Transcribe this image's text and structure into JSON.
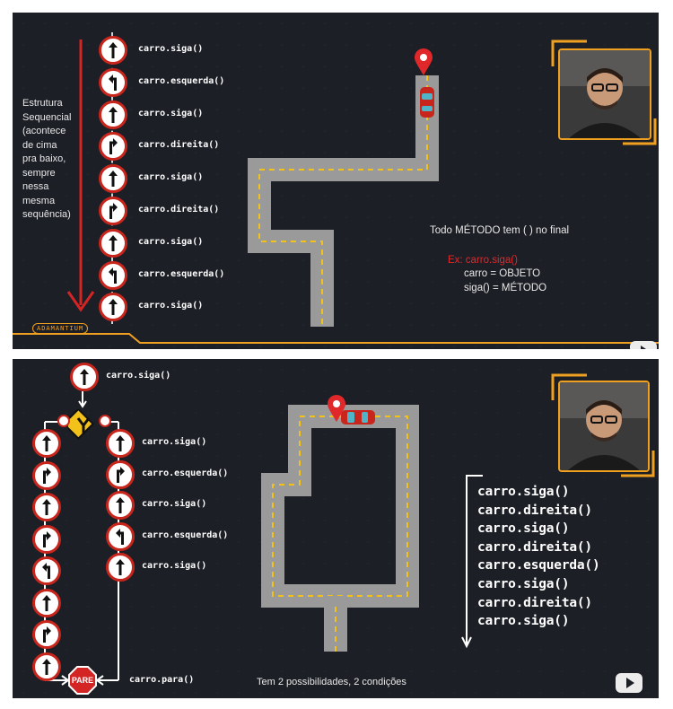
{
  "panel1": {
    "sidebar_text": [
      "Estrutura",
      "Sequencial",
      "(acontece",
      "de cima",
      "pra baixo,",
      "sempre",
      "nessa",
      "mesma",
      "sequência)"
    ],
    "commands": [
      {
        "icon": "arrow-up-icon",
        "label": "carro.siga()"
      },
      {
        "icon": "turn-left-icon",
        "label": "carro.esquerda()"
      },
      {
        "icon": "arrow-up-icon",
        "label": "carro.siga()"
      },
      {
        "icon": "turn-right-icon",
        "label": "carro.direita()"
      },
      {
        "icon": "arrow-up-icon",
        "label": "carro.siga()"
      },
      {
        "icon": "turn-right-icon",
        "label": "carro.direita()"
      },
      {
        "icon": "arrow-up-icon",
        "label": "carro.siga()"
      },
      {
        "icon": "turn-left-icon",
        "label": "carro.esquerda()"
      },
      {
        "icon": "arrow-up-icon",
        "label": "carro.siga()"
      }
    ],
    "note_title": "Todo MÉTODO tem ( ) no final",
    "example_label": "Ex: carro.siga()",
    "example_object": "carro = OBJETO",
    "example_method": "siga() = MÉTODO",
    "brand": "ADAMANTIUM"
  },
  "panel2": {
    "top_command": "carro.siga()",
    "left_signs": [
      "arrow-up-icon",
      "turn-right-icon",
      "arrow-up-icon",
      "turn-right-icon",
      "turn-left-icon",
      "arrow-up-icon",
      "turn-right-icon",
      "arrow-up-icon"
    ],
    "right_commands": [
      {
        "icon": "arrow-up-icon",
        "label": "carro.siga()"
      },
      {
        "icon": "turn-right-icon",
        "label": "carro.esquerda()"
      },
      {
        "icon": "arrow-up-icon",
        "label": "carro.siga()"
      },
      {
        "icon": "turn-left-icon",
        "label": "carro.esquerda()"
      },
      {
        "icon": "arrow-up-icon",
        "label": "carro.siga()"
      }
    ],
    "stop_sign": "PARE",
    "stop_command": "carro.para()",
    "sequence": [
      "carro.siga()",
      "carro.direita()",
      "carro.siga()",
      "carro.direita()",
      "carro.esquerda()",
      "carro.siga()",
      "carro.direita()",
      "carro.siga()"
    ],
    "footer_note": "Tem 2 possibilidades, 2 condições"
  },
  "colors": {
    "background": "#1d1f26",
    "sign_border": "#c8261c",
    "accent": "#f0a020",
    "road": "#9a9a9a",
    "lane": "#f2c21b"
  }
}
